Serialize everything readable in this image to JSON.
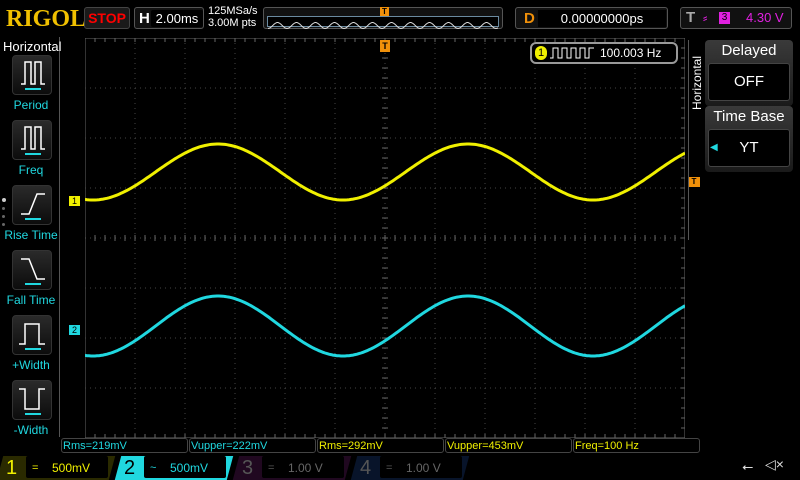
{
  "header": {
    "logo": "RIGOL",
    "run_state": "STOP",
    "h_label": "H",
    "timebase": "2.00ms",
    "sample_rate": "125MSa/s",
    "memory_depth": "3.00M pts",
    "d_label": "D",
    "delay": "0.00000000ps",
    "t_label": "T",
    "trigger_source": "3",
    "trigger_level": "4.30 V",
    "trigger_marker": "T"
  },
  "left_menu": {
    "title": "Horizontal",
    "items": [
      {
        "label": "Period"
      },
      {
        "label": "Freq"
      },
      {
        "label": "Rise Time"
      },
      {
        "label": "Fall Time"
      },
      {
        "label": "+Width"
      },
      {
        "label": "-Width"
      }
    ]
  },
  "right_menu": {
    "side_title": "Horizontal",
    "items": [
      {
        "title": "Delayed",
        "value": "OFF"
      },
      {
        "title": "Time Base",
        "value": "YT"
      }
    ]
  },
  "freq_counter": {
    "channel": "1",
    "value": "100.003 Hz"
  },
  "markers": {
    "ch1": "1",
    "ch2": "2",
    "trigger": "T"
  },
  "measurements": [
    {
      "text": "Rms=219mV",
      "color": "#20d8e0"
    },
    {
      "text": "Vupper=222mV",
      "color": "#20d8e0"
    },
    {
      "text": "Rms=292mV",
      "color": "#f0f000"
    },
    {
      "text": "Vupper=453mV",
      "color": "#f0f000"
    },
    {
      "text": "Freq=100 Hz",
      "color": "#f0f000"
    }
  ],
  "channels": [
    {
      "num": "1",
      "coupling": "=",
      "scale": "500mV",
      "color": "#f0f000",
      "active": true
    },
    {
      "num": "2",
      "coupling": "~",
      "scale": "500mV",
      "color": "#20d8e0",
      "active": true
    },
    {
      "num": "3",
      "coupling": "=",
      "scale": "1.00 V",
      "color": "#555",
      "active": false
    },
    {
      "num": "4",
      "coupling": "=",
      "scale": "1.00 V",
      "color": "#555",
      "active": false
    }
  ],
  "waveforms": [
    {
      "name": "ch1",
      "color": "#f0f000",
      "offset_div": 1.32,
      "amplitude_div": 0.56,
      "period_div": 5,
      "peak_div": -3.34
    },
    {
      "name": "ch2",
      "color": "#20d8e0",
      "offset_div": -1.76,
      "amplitude_div": 0.6,
      "period_div": 5,
      "peak_div": -3.34
    }
  ]
}
